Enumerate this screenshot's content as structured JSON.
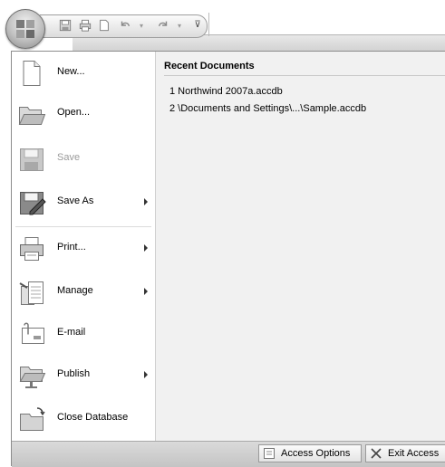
{
  "quick_access": {
    "buttons": [
      "save-icon",
      "print-icon",
      "new-document-icon",
      "undo-icon",
      "redo-icon",
      "customize-icon"
    ]
  },
  "commands": [
    {
      "label": "New...",
      "icon": "new-document-icon",
      "submenu": false,
      "enabled": true
    },
    {
      "label": "Open...",
      "icon": "open-folder-icon",
      "submenu": false,
      "enabled": true
    },
    {
      "label": "Save",
      "icon": "save-icon",
      "submenu": false,
      "enabled": false
    },
    {
      "label": "Save As",
      "icon": "save-as-icon",
      "submenu": true,
      "enabled": true
    },
    {
      "label": "Print...",
      "icon": "printer-icon",
      "submenu": true,
      "enabled": true
    },
    {
      "label": "Manage",
      "icon": "manage-icon",
      "submenu": true,
      "enabled": true
    },
    {
      "label": "E-mail",
      "icon": "email-icon",
      "submenu": false,
      "enabled": true
    },
    {
      "label": "Publish",
      "icon": "publish-icon",
      "submenu": true,
      "enabled": true
    },
    {
      "label": "Close Database",
      "icon": "close-database-icon",
      "submenu": false,
      "enabled": true
    }
  ],
  "recent": {
    "title": "Recent Documents",
    "items": [
      "1 Northwind 2007a.accdb",
      "2 \\Documents and Settings\\...\\Sample.accdb"
    ]
  },
  "footer": {
    "options_label": "Access Options",
    "exit_label": "Exit Access"
  },
  "colors": {
    "menu_background": "#f1f1f1",
    "command_background": "#ffffff",
    "disabled_text": "#9a9a9a"
  }
}
